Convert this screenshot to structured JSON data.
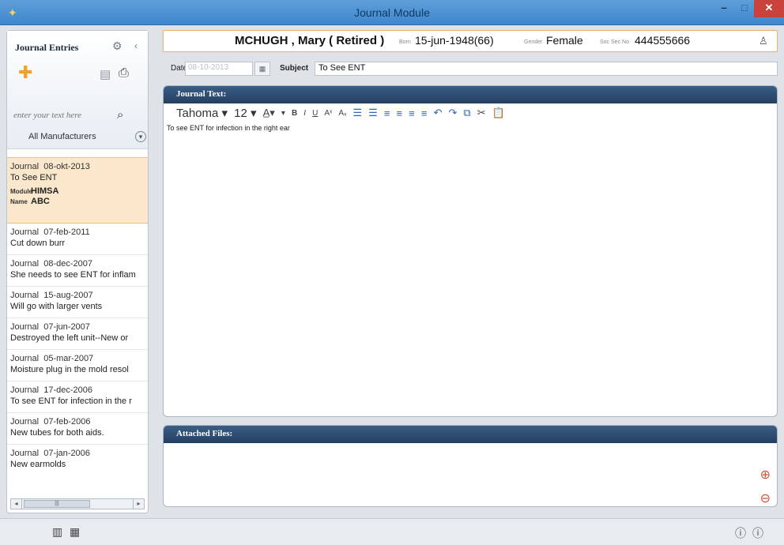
{
  "window": {
    "title": "Journal Module",
    "min": "–",
    "max": "□",
    "close": "✕"
  },
  "sidebar": {
    "title": "Journal Entries",
    "search_placeholder": "enter your text here",
    "filter_label": "All Manufacturers",
    "entries": [
      {
        "label": "Journal",
        "date": "08-okt-2013",
        "text": "To See ENT",
        "module_label": "Module",
        "module_value": "HIMSA",
        "name_label": "Name",
        "name_value": "ABC"
      },
      {
        "label": "Journal",
        "date": "07-feb-2011",
        "text": "Cut down burr"
      },
      {
        "label": "Journal",
        "date": "08-dec-2007",
        "text": "She needs to see ENT for  inflam"
      },
      {
        "label": "Journal",
        "date": "15-aug-2007",
        "text": "Will go with larger vents"
      },
      {
        "label": "Journal",
        "date": "07-jun-2007",
        "text": "Destroyed the left unit--New or"
      },
      {
        "label": "Journal",
        "date": "05-mar-2007",
        "text": "Moisture plug in the mold resol"
      },
      {
        "label": "Journal",
        "date": "17-dec-2006",
        "text": "To see ENT for infection in the r"
      },
      {
        "label": "Journal",
        "date": "07-feb-2006",
        "text": "New tubes for both aids."
      },
      {
        "label": "Journal",
        "date": "07-jan-2006",
        "text": "New earmolds"
      }
    ]
  },
  "patient": {
    "name": "MCHUGH , Mary  ( Retired )",
    "born_label": "Born",
    "born_value": "15-jun-1948(66)",
    "gender_label": "Gender",
    "gender_value": "Female",
    "ssn_label": "Soc Sec No",
    "ssn_value": "444555666"
  },
  "form": {
    "date_label": "Date",
    "date_value": "08-10-2013",
    "subject_label": "Subject",
    "subject_value": "To See ENT"
  },
  "journal": {
    "header": "Journal Text:",
    "font_name": "Tahoma",
    "font_size": "12",
    "body": "To see ENT for infection in the right ear"
  },
  "attached": {
    "header": "Attached Files:"
  },
  "colors": {
    "accent": "#3f86cc",
    "selected_entry": "#fbe7cc",
    "panel_header": "#243f60",
    "close_button": "#c9423b"
  }
}
